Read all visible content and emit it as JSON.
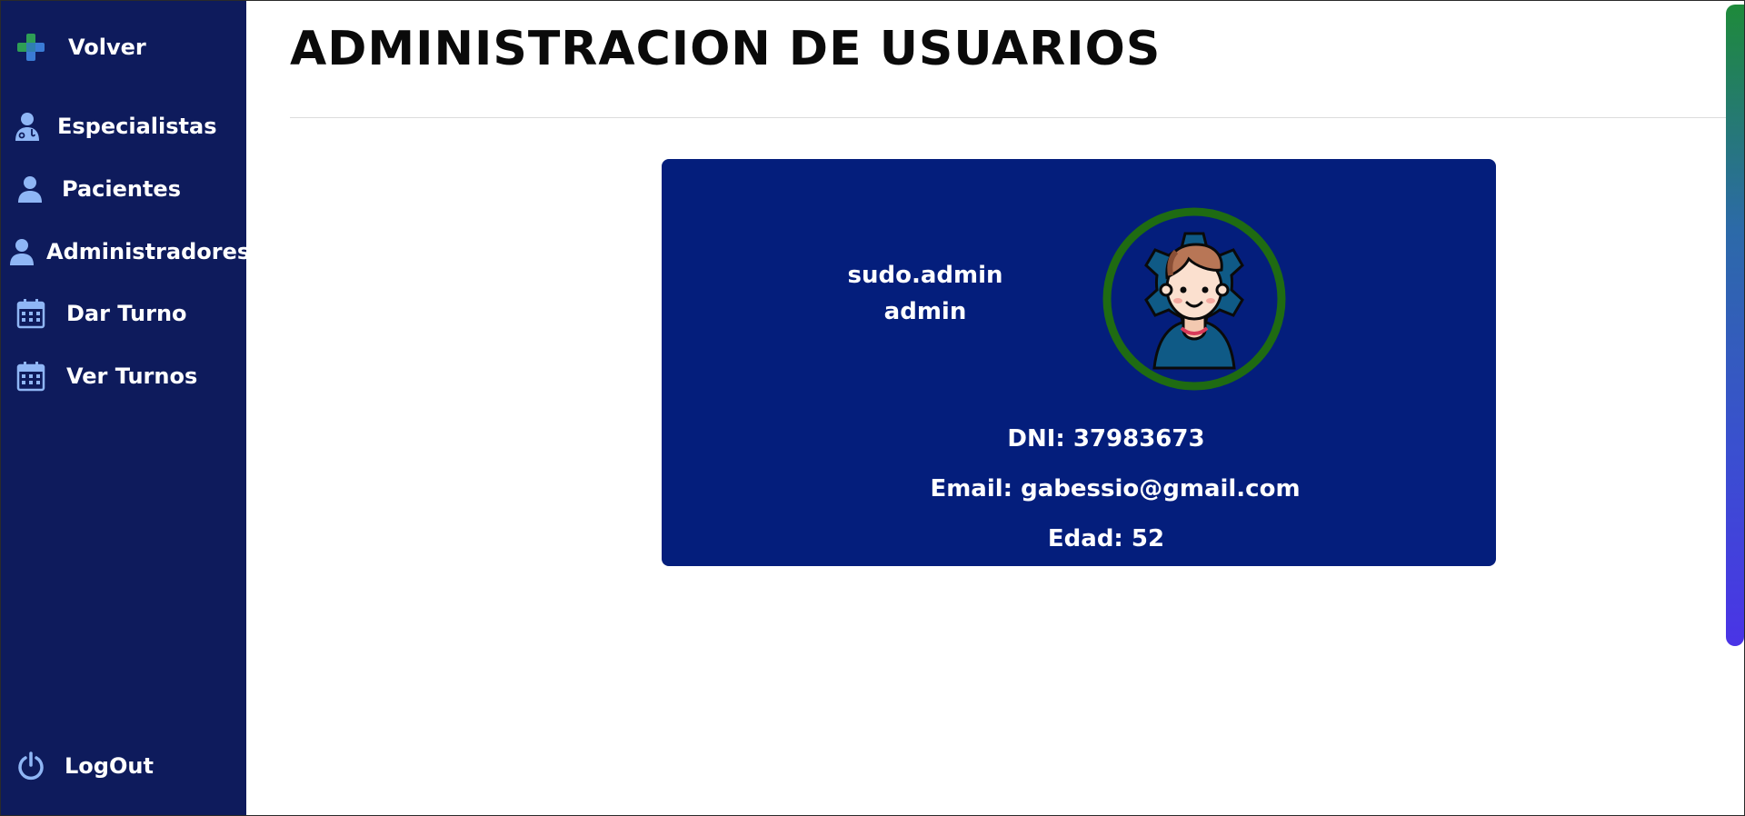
{
  "sidebar": {
    "back_label": "Volver",
    "items": [
      {
        "label": "Especialistas",
        "icon": "doctor-icon"
      },
      {
        "label": "Pacientes",
        "icon": "user-icon"
      },
      {
        "label": "Administradores",
        "icon": "user-icon"
      },
      {
        "label": "Dar Turno",
        "icon": "calendar-icon"
      },
      {
        "label": "Ver Turnos",
        "icon": "calendar-icon"
      }
    ],
    "logout_label": "LogOut",
    "logout_icon": "power-icon"
  },
  "page": {
    "title": "ADMINISTRACION DE USUARIOS"
  },
  "user_card": {
    "username": "sudo.admin",
    "role": "admin",
    "dni": "DNI: 37983673",
    "email": "Email: gabessio@gmail.com",
    "age": "Edad: 52",
    "avatar_ring_color": "#1f6b12"
  },
  "colors": {
    "sidebar_bg": "#0e1b5c",
    "card_bg": "#041e7c",
    "accent_icon": "#8fb6f5"
  }
}
